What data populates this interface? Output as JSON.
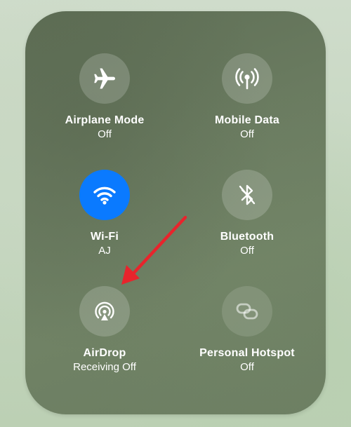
{
  "tiles": {
    "airplane": {
      "label": "Airplane Mode",
      "status": "Off",
      "icon": "airplane-icon",
      "active": false
    },
    "mobile_data": {
      "label": "Mobile Data",
      "status": "Off",
      "icon": "antenna-icon",
      "active": false
    },
    "wifi": {
      "label": "Wi-Fi",
      "status": "AJ",
      "icon": "wifi-icon",
      "active": true
    },
    "bluetooth": {
      "label": "Bluetooth",
      "status": "Off",
      "icon": "bluetooth-off-icon",
      "active": false
    },
    "airdrop": {
      "label": "AirDrop",
      "status": "Receiving Off",
      "icon": "airdrop-icon",
      "active": false
    },
    "hotspot": {
      "label": "Personal Hotspot",
      "status": "Off",
      "icon": "hotspot-icon",
      "active": false
    }
  },
  "colors": {
    "active_blue": "#0a7aff",
    "annotation_arrow": "#e8242c"
  }
}
